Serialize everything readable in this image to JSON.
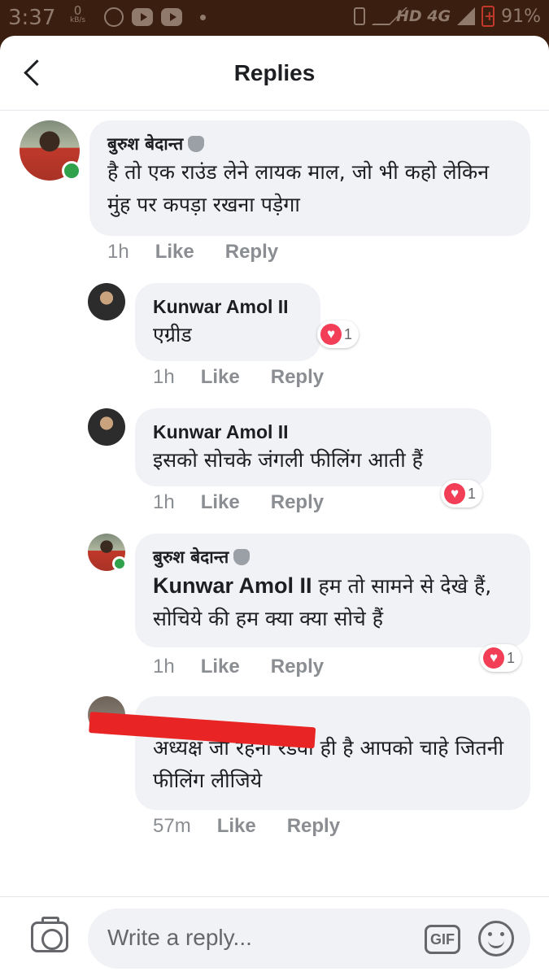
{
  "status_bar": {
    "time": "3:37",
    "net_speed_value": "0",
    "net_speed_unit": "kB/s",
    "network": "HD 4G",
    "battery": "91%"
  },
  "header": {
    "title": "Replies"
  },
  "comments": [
    {
      "author": "बुरुश बेदान्त",
      "text": "है तो एक राउंड लेने लायक माल, जो भी कहो लेकिन मुंह पर कपड़ा रखना पड़ेगा",
      "time": "1h",
      "like": "Like",
      "reply": "Reply"
    },
    {
      "author": "Kunwar Amol II",
      "text": "एग्रीड",
      "time": "1h",
      "like": "Like",
      "reply": "Reply",
      "reaction_count": "1"
    },
    {
      "author": "Kunwar Amol II",
      "text": "इसको सोचके जंगली फीलिंग आती हैं",
      "time": "1h",
      "like": "Like",
      "reply": "Reply",
      "reaction_count": "1"
    },
    {
      "author": "बुरुश बेदान्त",
      "mention": "Kunwar Amol II",
      "text": " हम तो सामने से देखे हैं, सोचिये की हम क्या क्या सोचे हैं",
      "time": "1h",
      "like": "Like",
      "reply": "Reply",
      "reaction_count": "1"
    },
    {
      "author": "",
      "text": "अध्यक्ष जी रहना रंडवा ही है आपको चाहे जितनी फीलिंग लीजिये",
      "time": "57m",
      "like": "Like",
      "reply": "Reply"
    }
  ],
  "composer": {
    "placeholder": "Write a reply...",
    "gif_label": "GIF"
  },
  "colors": {
    "bubble": "#f0f2f5",
    "online": "#31a24c",
    "reaction_love": "#f33e58",
    "redaction": "#e82424"
  }
}
